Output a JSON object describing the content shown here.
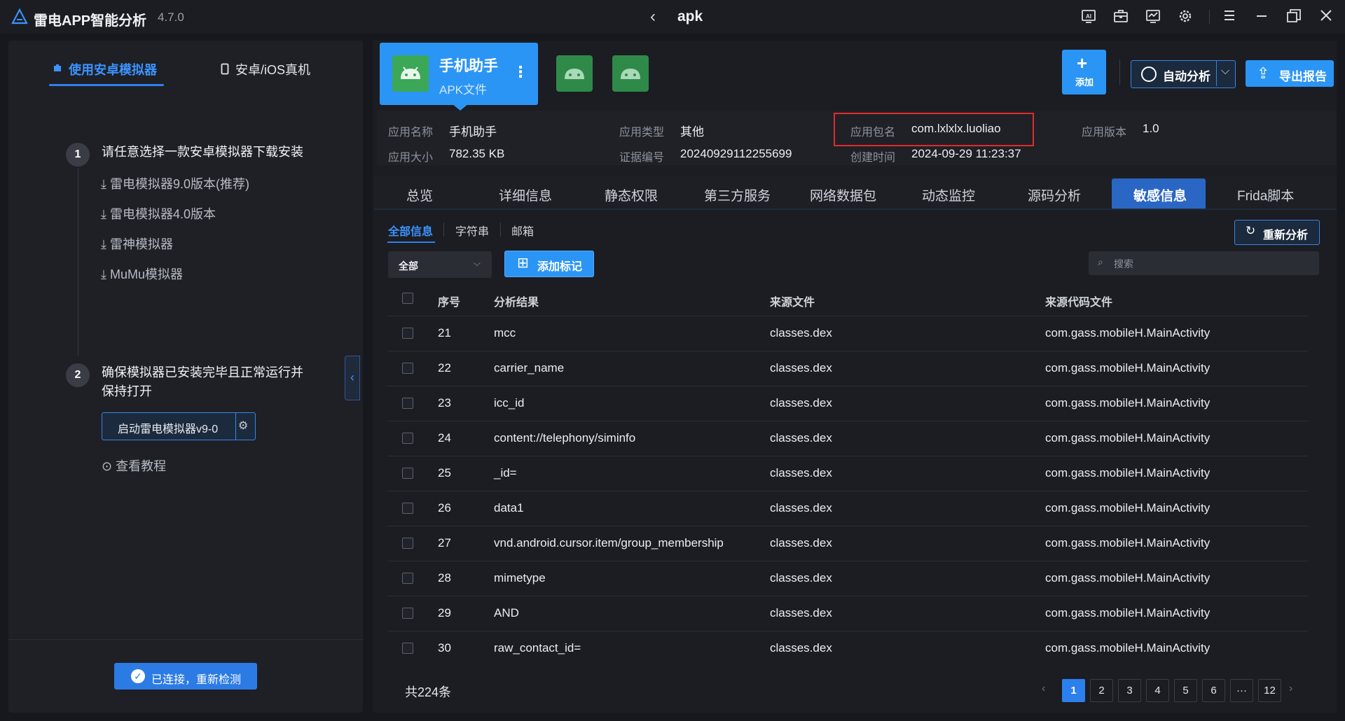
{
  "app": {
    "name": "雷电APP智能分析",
    "version": "4.7.0",
    "window_title": "apk"
  },
  "titlebar_icons": [
    "ai-report-icon",
    "toolbox-icon",
    "monitor-icon",
    "settings-icon",
    "menu-icon",
    "minimize-icon",
    "maximize-icon",
    "close-icon"
  ],
  "left_panel": {
    "tabs": [
      "使用安卓模拟器",
      "安卓/iOS真机"
    ],
    "step1": {
      "number": "1",
      "title": "请任意选择一款安卓模拟器下载安装",
      "links": [
        "雷电模拟器9.0版本(推荐)",
        "雷电模拟器4.0版本",
        "雷神模拟器",
        "MuMu模拟器"
      ]
    },
    "step2": {
      "number": "2",
      "title_line1": "确保模拟器已安装完毕且正常运行并",
      "title_line2": "保持打开",
      "launch_button": "启动雷电模拟器v9-0",
      "tutorial": "查看教程"
    },
    "connected_button": "已连接，重新检测"
  },
  "apk": {
    "name": "手机助手",
    "type": "APK文件"
  },
  "actions": {
    "add": "添加",
    "auto": "自动分析",
    "export": "导出报告"
  },
  "info": {
    "app_name_label": "应用名称",
    "app_name": "手机助手",
    "app_size_label": "应用大小",
    "app_size": "782.35 KB",
    "app_type_label": "应用类型",
    "app_type": "其他",
    "cert_label": "证据编号",
    "cert": "20240929112255699",
    "package_label": "应用包名",
    "package": "com.lxlxlx.luoliao",
    "created_label": "创建时间",
    "created": "2024-09-29 11:23:37",
    "version_label": "应用版本",
    "version": "1.0"
  },
  "tabs": [
    "总览",
    "详细信息",
    "静态权限",
    "第三方服务",
    "网络数据包",
    "动态监控",
    "源码分析",
    "敏感信息",
    "Frida脚本"
  ],
  "active_tab": "敏感信息",
  "sub_tabs": [
    "全部信息",
    "字符串",
    "邮箱"
  ],
  "toolbar": {
    "filter": "全部",
    "add_mark": "添加标记",
    "search_placeholder": "搜索",
    "reanalyze": "重新分析"
  },
  "table": {
    "headers": [
      "序号",
      "分析结果",
      "来源文件",
      "来源代码文件"
    ],
    "rows": [
      [
        "21",
        "mcc",
        "classes.dex",
        "com.gass.mobileH.MainActivity"
      ],
      [
        "22",
        "carrier_name",
        "classes.dex",
        "com.gass.mobileH.MainActivity"
      ],
      [
        "23",
        "icc_id",
        "classes.dex",
        "com.gass.mobileH.MainActivity"
      ],
      [
        "24",
        "content://telephony/siminfo",
        "classes.dex",
        "com.gass.mobileH.MainActivity"
      ],
      [
        "25",
        "_id=",
        "classes.dex",
        "com.gass.mobileH.MainActivity"
      ],
      [
        "26",
        "data1",
        "classes.dex",
        "com.gass.mobileH.MainActivity"
      ],
      [
        "27",
        "vnd.android.cursor.item/group_membership",
        "classes.dex",
        "com.gass.mobileH.MainActivity"
      ],
      [
        "28",
        "mimetype",
        "classes.dex",
        "com.gass.mobileH.MainActivity"
      ],
      [
        "29",
        "AND",
        "classes.dex",
        "com.gass.mobileH.MainActivity"
      ],
      [
        "30",
        "raw_contact_id=",
        "classes.dex",
        "com.gass.mobileH.MainActivity"
      ]
    ]
  },
  "pagination": {
    "total": "共224条",
    "pages": [
      "1",
      "2",
      "3",
      "4",
      "5",
      "6",
      "···",
      "12"
    ],
    "current": "1"
  },
  "colors": {
    "accent": "#2b95f5",
    "highlight": "#e02b2b",
    "background": "#16181d"
  }
}
